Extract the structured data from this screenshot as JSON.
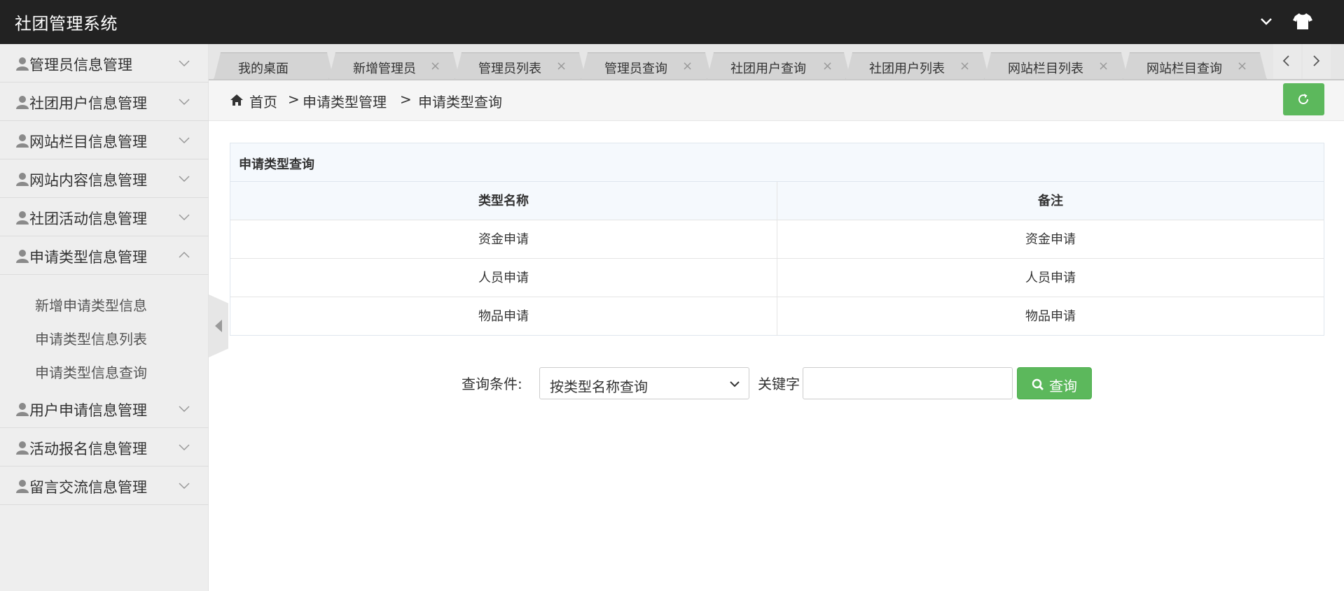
{
  "app": {
    "title": "社团管理系统"
  },
  "sidebar": {
    "items": [
      {
        "label": "管理员信息管理"
      },
      {
        "label": "社团用户信息管理"
      },
      {
        "label": "网站栏目信息管理"
      },
      {
        "label": "网站内容信息管理"
      },
      {
        "label": "社团活动信息管理"
      },
      {
        "label": "申请类型信息管理",
        "expanded": true
      },
      {
        "label": "用户申请信息管理"
      },
      {
        "label": "活动报名信息管理"
      },
      {
        "label": "留言交流信息管理"
      }
    ],
    "subitems": [
      {
        "label": "新增申请类型信息"
      },
      {
        "label": "申请类型信息列表"
      },
      {
        "label": "申请类型信息查询"
      }
    ]
  },
  "tabs": [
    {
      "label": "我的桌面"
    },
    {
      "label": "新增管理员",
      "close": "×"
    },
    {
      "label": "管理员列表",
      "close": "×"
    },
    {
      "label": "管理员查询",
      "close": "×"
    },
    {
      "label": "社团用户查询",
      "close": "×"
    },
    {
      "label": "社团用户列表",
      "close": "×"
    },
    {
      "label": "网站栏目列表",
      "close": "×"
    },
    {
      "label": "网站栏目查询",
      "close": "×"
    }
  ],
  "breadcrumb": {
    "home": "首页",
    "sep": ">",
    "level1": "申请类型管理",
    "level2": "申请类型查询"
  },
  "panel": {
    "title": "申请类型查询",
    "columns": [
      "类型名称",
      "备注"
    ],
    "rows": [
      [
        "资金申请",
        "资金申请"
      ],
      [
        "人员申请",
        "人员申请"
      ],
      [
        "物品申请",
        "物品申请"
      ]
    ]
  },
  "search": {
    "condition_label": "查询条件:",
    "select_value": "按类型名称查询",
    "keyword_label": "关键字",
    "keyword_value": "",
    "button_label": "查询"
  },
  "colors": {
    "topbar": "#222222",
    "sidebar": "#eeeeee",
    "accent_green": "#5cb85c"
  }
}
